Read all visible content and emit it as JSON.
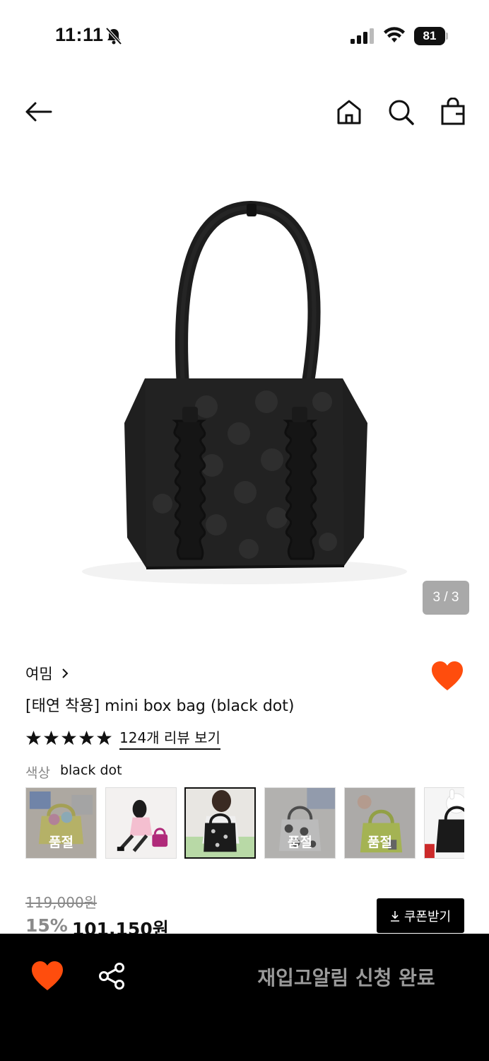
{
  "status_bar": {
    "time": "11:11",
    "battery_level": "81",
    "icons": [
      "bell-off-icon",
      "signal-icon",
      "wifi-icon",
      "battery-icon"
    ]
  },
  "nav": {
    "icons": [
      "back-arrow-icon",
      "home-icon",
      "search-icon",
      "shopping-bag-icon"
    ]
  },
  "gallery": {
    "counter": "3 / 3"
  },
  "product": {
    "brand": "여밈",
    "title": "[태연 착용] mini box bag (black dot)",
    "rating_stars": 5,
    "review_link": "124개 리뷰 보기",
    "option_label": "색상",
    "option_value": "black dot",
    "liked": true
  },
  "thumbnails": [
    {
      "variant": "yellow bag with cushions",
      "soldout": true,
      "label": "품절"
    },
    {
      "variant": "pink bag worn by model",
      "soldout": false,
      "label": ""
    },
    {
      "variant": "black dot bag",
      "soldout": false,
      "selected": true,
      "label": ""
    },
    {
      "variant": "white dot bag",
      "soldout": true,
      "label": "품절"
    },
    {
      "variant": "lime bag",
      "soldout": true,
      "label": "품절"
    },
    {
      "variant": "black bag with plush",
      "soldout": false,
      "label": ""
    }
  ],
  "price": {
    "original": "119,000원",
    "discount_rate": "15%",
    "sale": "101,150원",
    "coupon_label": "쿠폰받기"
  },
  "bottom_bar": {
    "restock_label": "재입고알림 신청 완료",
    "accent": "#ff4d0d"
  }
}
